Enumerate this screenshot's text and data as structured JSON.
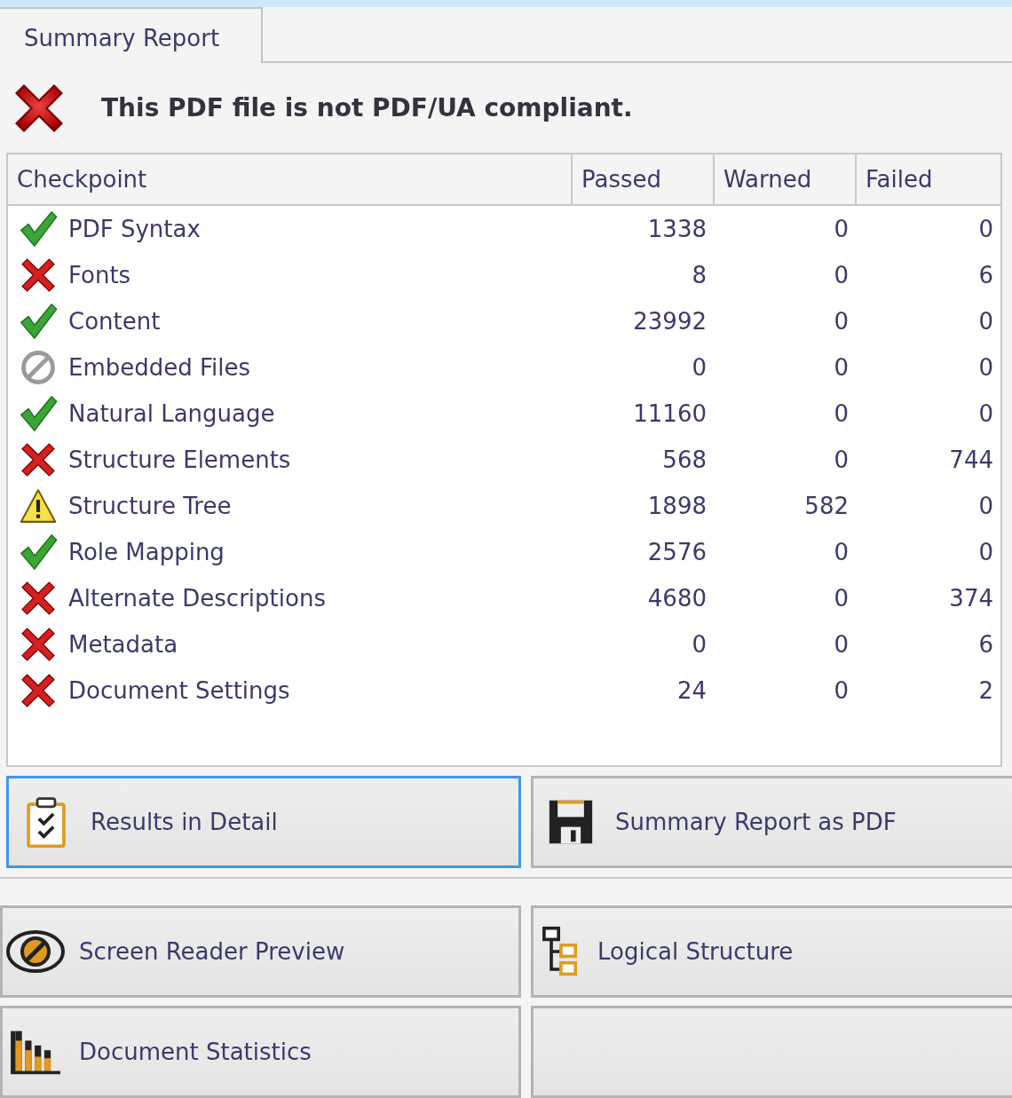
{
  "tabs": [
    {
      "label": "Summary Report",
      "selected": true
    }
  ],
  "verdict": {
    "kind": "fail",
    "message": "This PDF file is not PDF/UA compliant."
  },
  "table": {
    "columns": [
      "Checkpoint",
      "Passed",
      "Warned",
      "Failed"
    ],
    "rows": [
      {
        "kind": "pass",
        "name": "PDF Syntax",
        "passed": "1338",
        "warned": "0",
        "failed": "0"
      },
      {
        "kind": "fail",
        "name": "Fonts",
        "passed": "8",
        "warned": "0",
        "failed": "6"
      },
      {
        "kind": "pass",
        "name": "Content",
        "passed": "23992",
        "warned": "0",
        "failed": "0"
      },
      {
        "kind": "none",
        "name": "Embedded Files",
        "passed": "0",
        "warned": "0",
        "failed": "0"
      },
      {
        "kind": "pass",
        "name": "Natural Language",
        "passed": "11160",
        "warned": "0",
        "failed": "0"
      },
      {
        "kind": "fail",
        "name": "Structure Elements",
        "passed": "568",
        "warned": "0",
        "failed": "744"
      },
      {
        "kind": "warn",
        "name": "Structure Tree",
        "passed": "1898",
        "warned": "582",
        "failed": "0"
      },
      {
        "kind": "pass",
        "name": "Role Mapping",
        "passed": "2576",
        "warned": "0",
        "failed": "0"
      },
      {
        "kind": "fail",
        "name": "Alternate Descriptions",
        "passed": "4680",
        "warned": "0",
        "failed": "374"
      },
      {
        "kind": "fail",
        "name": "Metadata",
        "passed": "0",
        "warned": "0",
        "failed": "6"
      },
      {
        "kind": "fail",
        "name": "Document Settings",
        "passed": "24",
        "warned": "0",
        "failed": "2"
      }
    ]
  },
  "primary_buttons": [
    {
      "kind": "clipboard",
      "label": "Results in Detail",
      "focused": true
    },
    {
      "kind": "save",
      "label": "Summary Report as PDF",
      "focused": false
    }
  ],
  "tool_buttons": [
    {
      "kind": "eye",
      "label": "Screen Reader Preview"
    },
    {
      "kind": "tree",
      "label": "Logical Structure"
    },
    {
      "kind": "chart",
      "label": "Document Statistics"
    }
  ]
}
